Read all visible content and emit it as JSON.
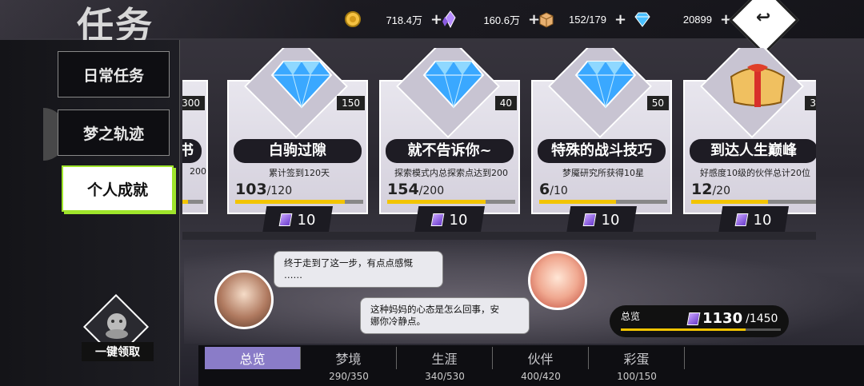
{
  "page_title": "任务",
  "resources": [
    {
      "icon": "gold-coin-icon",
      "value": "718.4万"
    },
    {
      "icon": "purple-crystal-icon",
      "value": "160.6万"
    },
    {
      "icon": "supply-box-icon",
      "value": "152/179"
    },
    {
      "icon": "blue-diamond-icon",
      "value": "20899"
    }
  ],
  "plus": "+",
  "back_glyph": "↩",
  "sidebar": {
    "tabs": [
      "日常任务",
      "梦之轨迹",
      "个人成就"
    ],
    "active": 2,
    "claim_all": "一键领取"
  },
  "partial_card": {
    "count": "300",
    "name_tail": "书",
    "desc_tail": "200"
  },
  "cards": [
    {
      "name": "白驹过隙",
      "desc": "累计签到120天",
      "current": "103",
      "total": "/120",
      "progress": 0.858,
      "count": "150",
      "reward": "10",
      "icon": "blue-diamond-icon"
    },
    {
      "name": "就不告诉你~",
      "desc": "探索模式内总探索点达到200",
      "current": "154",
      "total": "/200",
      "progress": 0.77,
      "count": "40",
      "reward": "10",
      "icon": "blue-diamond-icon"
    },
    {
      "name": "特殊的战斗技巧",
      "desc": "梦魇研究所获得10星",
      "current": "6",
      "total": "/10",
      "progress": 0.6,
      "count": "50",
      "reward": "10",
      "icon": "blue-diamond-icon"
    },
    {
      "name": "到达人生巅峰",
      "desc": "好感度10级的伙伴总计20位",
      "current": "12",
      "total": "/20",
      "progress": 0.6,
      "count": "3",
      "reward": "10",
      "icon": "gift-box-icon"
    }
  ],
  "dialog": {
    "line1": "终于走到了这一步，有点点感慨",
    "line1b": "……",
    "line2": "这种妈妈的心态是怎么回事，安",
    "line2b": "娜你冷静点。"
  },
  "summary": {
    "label": "总览",
    "current": "1130",
    "total": "/1450",
    "progress": 0.779
  },
  "bottom_tabs": [
    {
      "label": "总览",
      "sub": ""
    },
    {
      "label": "梦境",
      "sub": "290/350"
    },
    {
      "label": "生涯",
      "sub": "340/530"
    },
    {
      "label": "伙伴",
      "sub": "400/420"
    },
    {
      "label": "彩蛋",
      "sub": "100/150"
    }
  ],
  "colors": {
    "accent": "#9fe52b",
    "progress": "#f2c400",
    "active_tab": "#8a7cc8"
  }
}
